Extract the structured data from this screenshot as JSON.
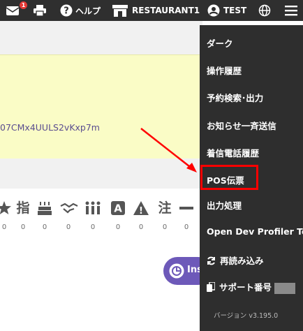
{
  "header": {
    "mail_badge": "1",
    "help_label": "ヘルプ",
    "restaurant_label": "RESTAURANT1",
    "user_label": "TEST"
  },
  "main": {
    "token_text": "07CMx4UULS2vKxp7m",
    "icon_row": [
      {
        "name": "star-icon",
        "glyph": "star",
        "count": "0"
      },
      {
        "name": "shitei-icon",
        "glyph": "指",
        "count": "0"
      },
      {
        "name": "birthday-cake-icon",
        "glyph": "cake",
        "count": "0"
      },
      {
        "name": "handshake-icon",
        "glyph": "handshake",
        "count": "0"
      },
      {
        "name": "group-icon",
        "glyph": "group",
        "count": "0"
      },
      {
        "name": "letter-a-icon",
        "glyph": "A",
        "count": "0"
      },
      {
        "name": "warning-icon",
        "glyph": "!",
        "count": "0"
      },
      {
        "name": "chu-icon",
        "glyph": "注",
        "count": "0"
      },
      {
        "name": "dash-icon",
        "glyph": "dash",
        "count": "0"
      }
    ],
    "fab_label": "Ins"
  },
  "menu": {
    "items": [
      {
        "label": "ダーク"
      },
      {
        "label": "操作履歴"
      },
      {
        "label": "予約検索･出力"
      },
      {
        "label": "お知らせ一斉送信"
      },
      {
        "label": "着信電話履歴"
      },
      {
        "label": "POS伝票"
      },
      {
        "label": "出力処理"
      },
      {
        "label": "Open Dev Profiler Tool"
      },
      {
        "label": "再読み込み"
      },
      {
        "label": "サポート番号"
      }
    ],
    "version": "バージョン v3.195.0"
  },
  "colors": {
    "topbar": "#2f2f2f",
    "menu": "#2e2e2e",
    "highlight_box": "#ff0000",
    "arrow": "#ff0000",
    "yellow_panel": "#fafcc6",
    "fab": "#6d59b9"
  }
}
